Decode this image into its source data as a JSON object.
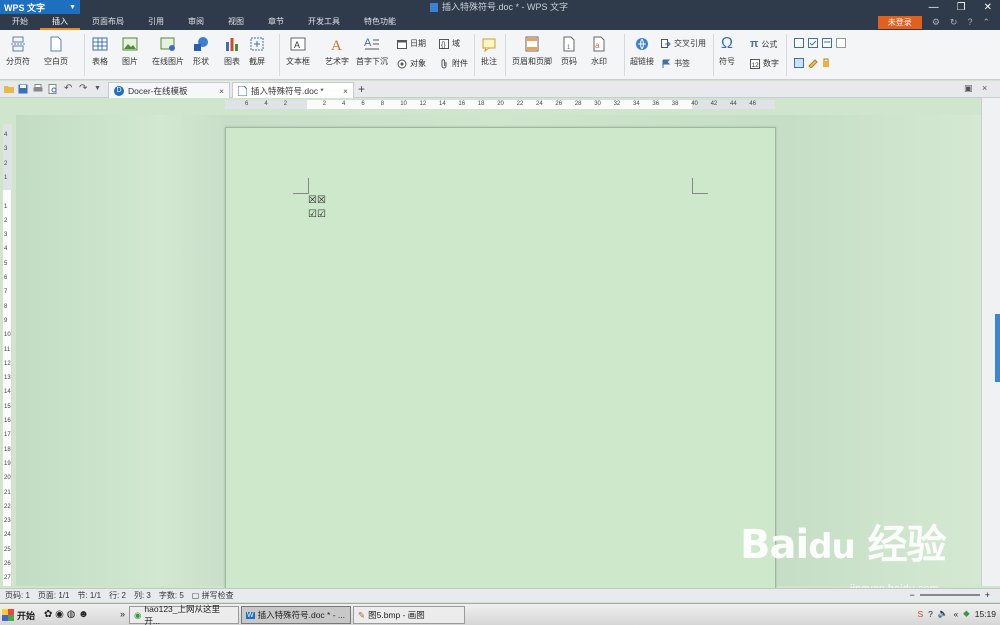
{
  "titlebar": {
    "app_button": "WPS 文字",
    "document_title": "插入特殊符号.doc * - WPS 文字"
  },
  "menu": {
    "tabs": [
      "开始",
      "插入",
      "页面布局",
      "引用",
      "审阅",
      "视图",
      "章节",
      "开发工具",
      "特色功能"
    ],
    "active": "插入",
    "login": "未登录"
  },
  "ribbon": {
    "fenyefu": "分页符",
    "kongbaiye": "空白页",
    "biaoge": "表格",
    "tupian": "图片",
    "zaixiantupian": "在线图片",
    "xingzhuang": "形状",
    "tubiao": "图表",
    "jieping": "截屏",
    "wenbenkuang": "文本框",
    "yishuzi": "艺术字",
    "shouzixiachen": "首字下沉",
    "riqi": "日期",
    "yu": "域",
    "duixiang": "对象",
    "fujian": "附件",
    "pizhu": "批注",
    "yemeiheyejiao": "页眉和页脚",
    "yema": "页码",
    "shuiyin": "水印",
    "chaolianjie": "超链接",
    "jiaochayinyong": "交叉引用",
    "shuqian": "书签",
    "fuhao": "符号",
    "gongshi": "公式",
    "shuzi": "数字"
  },
  "tabs": {
    "docer": "Docer-在线模板",
    "document": "插入特殊符号.doc *"
  },
  "ruler": {
    "h_ticks": [
      "6",
      "4",
      "2",
      "",
      "2",
      "4",
      "6",
      "8",
      "10",
      "12",
      "14",
      "16",
      "18",
      "20",
      "22",
      "24",
      "26",
      "28",
      "30",
      "32",
      "34",
      "36",
      "38",
      "40",
      "42",
      "44",
      "46"
    ],
    "v_ticks": [
      "4",
      "3",
      "2",
      "1",
      "",
      "1",
      "2",
      "3",
      "4",
      "5",
      "6",
      "7",
      "8",
      "9",
      "10",
      "11",
      "12",
      "13",
      "14",
      "15",
      "16",
      "17",
      "18",
      "19",
      "20",
      "21",
      "22",
      "23",
      "24",
      "25",
      "26",
      "27"
    ]
  },
  "document": {
    "line1": "☒☒",
    "line2": "☑☑"
  },
  "status": {
    "page_num": "页码: 1",
    "pages": "页面: 1/1",
    "section": "节: 1/1",
    "row": "行: 2",
    "col": "列: 3",
    "words": "字数: 5",
    "spellcheck": "拼写检查"
  },
  "taskbar": {
    "start": "开始",
    "tasks": [
      "hao123_上网从这里开...",
      "插入特殊符号.doc * - ...",
      "图5.bmp - 画图"
    ],
    "time": "15:19"
  },
  "watermark": {
    "text": "Bai du 经验",
    "url": "jingyan.baidu.com"
  },
  "colors": {
    "titlebar": "#2f3a4a",
    "accent_orange": "#f08a1c",
    "wps_blue": "#1d6fc0",
    "page_green": "#cde8cb"
  }
}
